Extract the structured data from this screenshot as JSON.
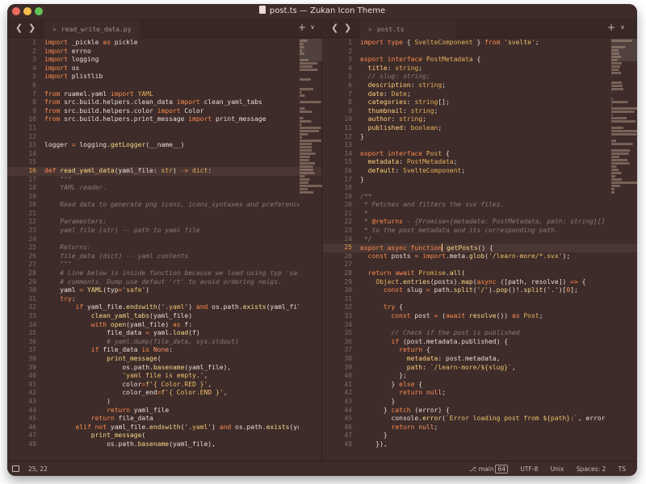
{
  "window": {
    "title": "post.ts — Zukan Icon Theme"
  },
  "left_pane": {
    "tab": {
      "label": "read_write_data.py"
    },
    "current_line": 16,
    "lines": [
      [
        [
          "kw",
          "import"
        ],
        [
          "t",
          " _pickle "
        ],
        [
          "kw",
          "as"
        ],
        [
          "t",
          " pickle"
        ]
      ],
      [
        [
          "kw",
          "import"
        ],
        [
          "t",
          " errno"
        ]
      ],
      [
        [
          "kw",
          "import"
        ],
        [
          "t",
          " logging"
        ]
      ],
      [
        [
          "kw",
          "import"
        ],
        [
          "t",
          " os"
        ]
      ],
      [
        [
          "kw",
          "import"
        ],
        [
          "t",
          " plistlib"
        ]
      ],
      [],
      [
        [
          "kw",
          "from"
        ],
        [
          "t",
          " ruamel.yaml "
        ],
        [
          "kw",
          "import"
        ],
        [
          "ty",
          " YAML"
        ]
      ],
      [
        [
          "kw",
          "from"
        ],
        [
          "t",
          " src.build.helpers.clean_data "
        ],
        [
          "kw",
          "import"
        ],
        [
          "t",
          " clean_yaml_tabs"
        ]
      ],
      [
        [
          "kw",
          "from"
        ],
        [
          "t",
          " src.build.helpers.color "
        ],
        [
          "kw",
          "import"
        ],
        [
          "t",
          " Color"
        ]
      ],
      [
        [
          "kw",
          "from"
        ],
        [
          "t",
          " src.build.helpers.print_message "
        ],
        [
          "kw",
          "import"
        ],
        [
          "t",
          " print_message"
        ]
      ],
      [],
      [],
      [
        [
          "t",
          "logger "
        ],
        [
          "kw",
          "="
        ],
        [
          "t",
          " logging."
        ],
        [
          "fn",
          "getLogger"
        ],
        [
          "t",
          "(__name__)"
        ]
      ],
      [],
      [],
      [
        [
          "kw",
          "def"
        ],
        [
          "fn",
          " read_yaml_data"
        ],
        [
          "t",
          "(yaml_file: "
        ],
        [
          "ty",
          "str"
        ],
        [
          "t",
          ") "
        ],
        [
          "kw",
          "->"
        ],
        [
          "ty",
          " dict"
        ],
        [
          "t",
          ":"
        ]
      ],
      [
        [
          "cm",
          "    \"\"\""
        ]
      ],
      [
        [
          "cm",
          "    YAML reader."
        ]
      ],
      [],
      [
        [
          "cm",
          "    Read data to generate png icons, icons_syntaxes and preferences"
        ]
      ],
      [],
      [
        [
          "cm",
          "    Paramenters:"
        ]
      ],
      [
        [
          "cm",
          "    yaml_file (str) -- path to yaml file"
        ]
      ],
      [],
      [
        [
          "cm",
          "    Returns:"
        ]
      ],
      [
        [
          "cm",
          "    file_data (dict) -- yaml contents"
        ]
      ],
      [
        [
          "cm",
          "    \"\"\""
        ]
      ],
      [
        [
          "cm",
          "    # Line below is inside function because we load using typ 'safe'"
        ]
      ],
      [
        [
          "cm",
          "    # comments. Dump use defaut 'rt' to avoid ordering neigs."
        ]
      ],
      [
        [
          "t",
          "    yaml "
        ],
        [
          "kw",
          "="
        ],
        [
          "fn",
          " YAML"
        ],
        [
          "t",
          "(typ"
        ],
        [
          "kw",
          "="
        ],
        [
          "str",
          "'safe'"
        ],
        [
          "t",
          ")"
        ]
      ],
      [
        [
          "kw",
          "    try"
        ],
        [
          "t",
          ":"
        ]
      ],
      [
        [
          "kw",
          "        if"
        ],
        [
          "t",
          " yaml_file."
        ],
        [
          "fn",
          "endswith"
        ],
        [
          "t",
          "("
        ],
        [
          "str",
          "'.yaml'"
        ],
        [
          "t",
          ") "
        ],
        [
          "kw",
          "and"
        ],
        [
          "t",
          " os.path."
        ],
        [
          "fn",
          "exists"
        ],
        [
          "t",
          "(yaml_file):"
        ]
      ],
      [
        [
          "fn",
          "            clean_yaml_tabs"
        ],
        [
          "t",
          "(yaml_file)"
        ]
      ],
      [
        [
          "kw",
          "            with"
        ],
        [
          "fn",
          " open"
        ],
        [
          "t",
          "(yaml_file) "
        ],
        [
          "kw",
          "as"
        ],
        [
          "t",
          " f:"
        ]
      ],
      [
        [
          "t",
          "                file_data "
        ],
        [
          "kw",
          "="
        ],
        [
          "t",
          " yaml."
        ],
        [
          "fn",
          "load"
        ],
        [
          "t",
          "(f)"
        ]
      ],
      [
        [
          "cm",
          "                # yaml.dump(file_data, sys.stdout)"
        ]
      ],
      [
        [
          "kw",
          "            if"
        ],
        [
          "t",
          " file_data "
        ],
        [
          "kw",
          "is"
        ],
        [
          "num",
          " None"
        ],
        [
          "t",
          ":"
        ]
      ],
      [
        [
          "fn",
          "                print_message"
        ],
        [
          "t",
          "("
        ]
      ],
      [
        [
          "t",
          "                    os.path."
        ],
        [
          "fn",
          "basename"
        ],
        [
          "t",
          "(yaml_file),"
        ]
      ],
      [
        [
          "str",
          "                    'yaml file is empty.'"
        ],
        [
          "t",
          ","
        ]
      ],
      [
        [
          "t",
          "                    color"
        ],
        [
          "kw",
          "="
        ],
        [
          "str",
          "f'{ Color.RED }'"
        ],
        [
          "t",
          ","
        ]
      ],
      [
        [
          "t",
          "                    color_end"
        ],
        [
          "kw",
          "="
        ],
        [
          "str",
          "f'{ Color.END }'"
        ],
        [
          "t",
          ","
        ]
      ],
      [
        [
          "t",
          "                )"
        ]
      ],
      [
        [
          "kw",
          "                return"
        ],
        [
          "t",
          " yaml_file"
        ]
      ],
      [
        [
          "kw",
          "            return"
        ],
        [
          "t",
          " file_data"
        ]
      ],
      [
        [
          "kw",
          "        elif not"
        ],
        [
          "t",
          " yaml_file."
        ],
        [
          "fn",
          "endswith"
        ],
        [
          "t",
          "("
        ],
        [
          "str",
          "'.yaml'"
        ],
        [
          "t",
          ") "
        ],
        [
          "kw",
          "and"
        ],
        [
          "t",
          " os.path."
        ],
        [
          "fn",
          "exists"
        ],
        [
          "t",
          "(yaml_file):"
        ]
      ],
      [
        [
          "fn",
          "            print_message"
        ],
        [
          "t",
          "("
        ]
      ],
      [
        [
          "t",
          "                os.path."
        ],
        [
          "fn",
          "basename"
        ],
        [
          "t",
          "(yaml_file),"
        ]
      ]
    ]
  },
  "right_pane": {
    "tab": {
      "label": "post.ts"
    },
    "current_line": 25,
    "lines": [
      [
        [
          "kw",
          "import type"
        ],
        [
          "t",
          " { "
        ],
        [
          "ty",
          "SvelteComponent"
        ],
        [
          "t",
          " } "
        ],
        [
          "kw",
          "from"
        ],
        [
          "str",
          " 'svelte'"
        ],
        [
          "t",
          ";"
        ]
      ],
      [],
      [
        [
          "kw",
          "export interface"
        ],
        [
          "ty",
          " PostMetadata"
        ],
        [
          "t",
          " {"
        ]
      ],
      [
        [
          "pr",
          "  title"
        ],
        [
          "t",
          ": "
        ],
        [
          "ty",
          "string"
        ],
        [
          "t",
          ";"
        ]
      ],
      [
        [
          "cm",
          "  // slug: string;"
        ]
      ],
      [
        [
          "pr",
          "  description"
        ],
        [
          "t",
          ": "
        ],
        [
          "ty",
          "string"
        ],
        [
          "t",
          ";"
        ]
      ],
      [
        [
          "pr",
          "  date"
        ],
        [
          "t",
          ": "
        ],
        [
          "ty",
          "Date"
        ],
        [
          "t",
          ";"
        ]
      ],
      [
        [
          "pr",
          "  categories"
        ],
        [
          "t",
          ": "
        ],
        [
          "ty",
          "string"
        ],
        [
          "t",
          "[];"
        ]
      ],
      [
        [
          "pr",
          "  thumbnail"
        ],
        [
          "t",
          ": "
        ],
        [
          "ty",
          "string"
        ],
        [
          "t",
          ";"
        ]
      ],
      [
        [
          "pr",
          "  author"
        ],
        [
          "t",
          ": "
        ],
        [
          "ty",
          "string"
        ],
        [
          "t",
          ";"
        ]
      ],
      [
        [
          "pr",
          "  published"
        ],
        [
          "t",
          ": "
        ],
        [
          "ty",
          "boolean"
        ],
        [
          "t",
          ";"
        ]
      ],
      [
        [
          "t",
          "}"
        ]
      ],
      [],
      [
        [
          "kw",
          "export interface"
        ],
        [
          "ty",
          " Post"
        ],
        [
          "t",
          " {"
        ]
      ],
      [
        [
          "pr",
          "  metadata"
        ],
        [
          "t",
          ": "
        ],
        [
          "ty",
          "PostMetadata"
        ],
        [
          "t",
          ";"
        ]
      ],
      [
        [
          "pr",
          "  default"
        ],
        [
          "t",
          ": "
        ],
        [
          "ty",
          "SvelteComponent"
        ],
        [
          "t",
          ";"
        ]
      ],
      [
        [
          "t",
          "}"
        ]
      ],
      [],
      [
        [
          "cm",
          "/**"
        ]
      ],
      [
        [
          "cm",
          " * Fetches and filters the svx files."
        ]
      ],
      [
        [
          "cm",
          " *"
        ]
      ],
      [
        [
          "cm",
          " * "
        ],
        [
          "kw",
          "@returns"
        ],
        [
          "cm",
          " - {Promise<{metadata: PostMetadata, path: string}[]>}"
        ]
      ],
      [
        [
          "cm",
          " * to the post metadata and its corresponding path."
        ]
      ],
      [
        [
          "cm",
          " */"
        ]
      ],
      [
        [
          "kw",
          "export async function"
        ],
        [
          "fn",
          " getPosts"
        ],
        [
          "t",
          "() {"
        ]
      ],
      [
        [
          "kw",
          "  const"
        ],
        [
          "t",
          " posts "
        ],
        [
          "kw",
          "="
        ],
        [
          "kw",
          " import"
        ],
        [
          "t",
          ".meta."
        ],
        [
          "fn",
          "glob"
        ],
        [
          "t",
          "("
        ],
        [
          "str",
          "'/learn-more/*.svx'"
        ],
        [
          "t",
          ");"
        ]
      ],
      [],
      [
        [
          "kw",
          "  return await"
        ],
        [
          "ty",
          " Promise"
        ],
        [
          "t",
          "."
        ],
        [
          "fn",
          "all"
        ],
        [
          "t",
          "("
        ]
      ],
      [
        [
          "ty",
          "    Object"
        ],
        [
          "t",
          "."
        ],
        [
          "fn",
          "entries"
        ],
        [
          "t",
          "(posts)."
        ],
        [
          "fn",
          "map"
        ],
        [
          "t",
          "("
        ],
        [
          "kw",
          "async"
        ],
        [
          "t",
          " ([path, resolve]) "
        ],
        [
          "kw",
          "=>"
        ],
        [
          "t",
          " {"
        ]
      ],
      [
        [
          "kw",
          "      const"
        ],
        [
          "t",
          " slug "
        ],
        [
          "kw",
          "="
        ],
        [
          "t",
          " path."
        ],
        [
          "fn",
          "split"
        ],
        [
          "t",
          "("
        ],
        [
          "str",
          "'/'"
        ],
        [
          "t",
          ")."
        ],
        [
          "fn",
          "pop"
        ],
        [
          "t",
          "()!."
        ],
        [
          "fn",
          "split"
        ],
        [
          "t",
          "("
        ],
        [
          "str",
          "'.'"
        ],
        [
          "t",
          ")["
        ],
        [
          "num",
          "0"
        ],
        [
          "t",
          "];"
        ]
      ],
      [],
      [
        [
          "kw",
          "      try"
        ],
        [
          "t",
          " {"
        ]
      ],
      [
        [
          "kw",
          "        const"
        ],
        [
          "t",
          " post "
        ],
        [
          "kw",
          "="
        ],
        [
          "t",
          " ("
        ],
        [
          "kw",
          "await"
        ],
        [
          "fn",
          " resolve"
        ],
        [
          "t",
          "()) "
        ],
        [
          "kw",
          "as"
        ],
        [
          "ty",
          " Post"
        ],
        [
          "t",
          ";"
        ]
      ],
      [],
      [
        [
          "cm",
          "        // Check if the post is published"
        ]
      ],
      [
        [
          "kw",
          "        if"
        ],
        [
          "t",
          " (post.metadata.published) {"
        ]
      ],
      [
        [
          "kw",
          "          return"
        ],
        [
          "t",
          " {"
        ]
      ],
      [
        [
          "pr",
          "            metadata"
        ],
        [
          "t",
          ": post.metadata,"
        ]
      ],
      [
        [
          "pr",
          "            path"
        ],
        [
          "t",
          ": "
        ],
        [
          "str",
          "`/learn-more/${slug}`"
        ],
        [
          "t",
          ","
        ]
      ],
      [
        [
          "t",
          "          };"
        ]
      ],
      [
        [
          "t",
          "        } "
        ],
        [
          "kw",
          "else"
        ],
        [
          "t",
          " {"
        ]
      ],
      [
        [
          "kw",
          "          return"
        ],
        [
          "num",
          " null"
        ],
        [
          "t",
          ";"
        ]
      ],
      [
        [
          "t",
          "        }"
        ]
      ],
      [
        [
          "t",
          "      } "
        ],
        [
          "kw",
          "catch"
        ],
        [
          "t",
          " (error) {"
        ]
      ],
      [
        [
          "t",
          "        console."
        ],
        [
          "fn",
          "error"
        ],
        [
          "t",
          "("
        ],
        [
          "str",
          "`Error loading post from ${path}:`"
        ],
        [
          "t",
          ", error);"
        ]
      ],
      [
        [
          "kw",
          "        return"
        ],
        [
          "num",
          " null"
        ],
        [
          "t",
          ";"
        ]
      ],
      [
        [
          "t",
          "      }"
        ]
      ],
      [
        [
          "t",
          "    }),"
        ]
      ]
    ]
  },
  "status_bar": {
    "cursor_position": "25, 22",
    "branch_label": "main",
    "branch_count": "64",
    "encoding": "UTF-8",
    "line_endings": "Unix",
    "indentation": "Spaces: 2",
    "syntax": "TS"
  },
  "theme_colors": {
    "background": "#3d2c2a",
    "keyword": "#ff8a4c",
    "string": "#eec06a",
    "comment": "#8a7a72",
    "function": "#f8d887",
    "current_line_number": "#f0a050"
  }
}
